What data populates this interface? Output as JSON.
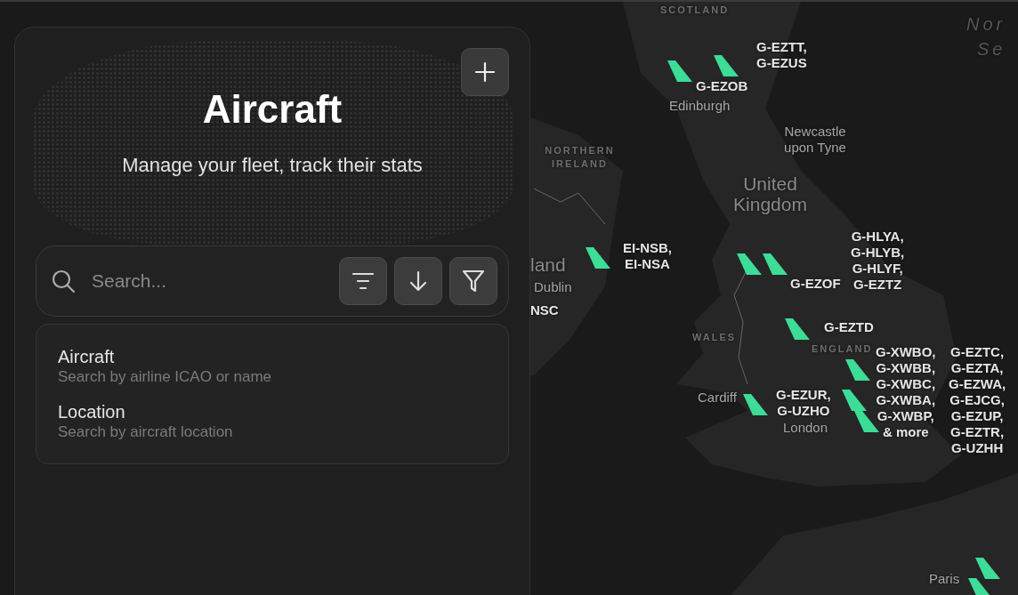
{
  "panel": {
    "title": "Aircraft",
    "subtitle": "Manage your fleet, track their stats",
    "search": {
      "placeholder": "Search..."
    },
    "search_options": [
      {
        "title": "Aircraft",
        "hint": "Search by airline ICAO or name"
      },
      {
        "title": "Location",
        "hint": "Search by aircraft location"
      }
    ]
  },
  "map": {
    "place_labels": [
      {
        "text": "SCOTLAND",
        "kind": "region"
      },
      {
        "text": "Nor",
        "kind": "sea"
      },
      {
        "text": "Se",
        "kind": "sea"
      },
      {
        "text": "Edinburgh",
        "kind": "city"
      },
      {
        "text": "Newcastle upon Tyne",
        "kind": "city"
      },
      {
        "text": "United Kingdom",
        "kind": "country"
      },
      {
        "text": "NORTHERN IRELAND",
        "kind": "region"
      },
      {
        "text": "land",
        "kind": "country"
      },
      {
        "text": "Dublin",
        "kind": "city"
      },
      {
        "text": "WALES",
        "kind": "region"
      },
      {
        "text": "ENGLAND",
        "kind": "region"
      },
      {
        "text": "Cardiff",
        "kind": "city"
      },
      {
        "text": "London",
        "kind": "city"
      },
      {
        "text": "Paris",
        "kind": "city"
      }
    ],
    "aircraft": [
      {
        "registrations": [
          "G-EZOB"
        ]
      },
      {
        "registrations": [
          "G-EZTT,",
          "G-EZUS"
        ]
      },
      {
        "registrations": [
          "EI-NSB,",
          "EI-NSA"
        ]
      },
      {
        "registrations": [
          "NSC"
        ]
      },
      {
        "registrations": [
          "G-EZOF"
        ]
      },
      {
        "registrations": [
          "G-HLYA,",
          "G-HLYB,",
          "G-HLYF,",
          "G-EZTZ"
        ]
      },
      {
        "registrations": [
          "G-EZTD"
        ]
      },
      {
        "registrations": [
          "G-EZUR,",
          "G-UZHO"
        ]
      },
      {
        "registrations": [
          "G-XWBO,",
          "G-XWBB,",
          "G-XWBC,",
          "G-XWBA,",
          "G-XWBP,",
          "& more"
        ]
      },
      {
        "registrations": [
          "G-EZTC,",
          "G-EZTA,",
          "G-EZWA,",
          "G-EJCG,",
          "G-EZUP,",
          "G-EZTR,",
          "G-UZHH"
        ]
      }
    ]
  }
}
